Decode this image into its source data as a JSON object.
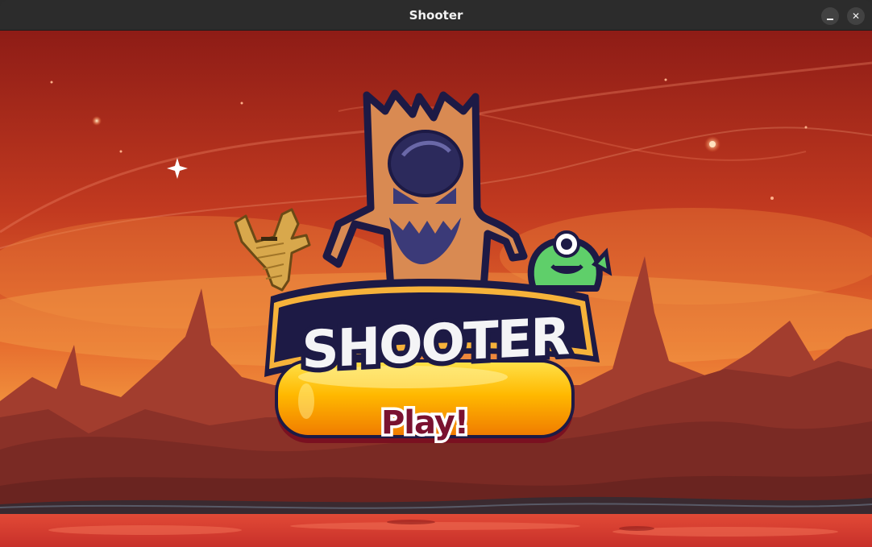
{
  "window": {
    "title": "Shooter",
    "minimize_icon": "minimize-icon",
    "close_icon": "close-icon",
    "close_glyph": "✕"
  },
  "game": {
    "logo_text": "SHOOTER",
    "play_label": "Play!",
    "characters": [
      "tree-monster",
      "mummy",
      "green-cyclops-alien"
    ],
    "colors": {
      "sky_top": "#8e1c16",
      "sky_mid": "#e0542a",
      "horizon": "#f5a043",
      "rocks": "#7d2b26",
      "lava": "#d8402e",
      "button": "#ffb300",
      "logo_outline": "#1d1a45"
    }
  }
}
